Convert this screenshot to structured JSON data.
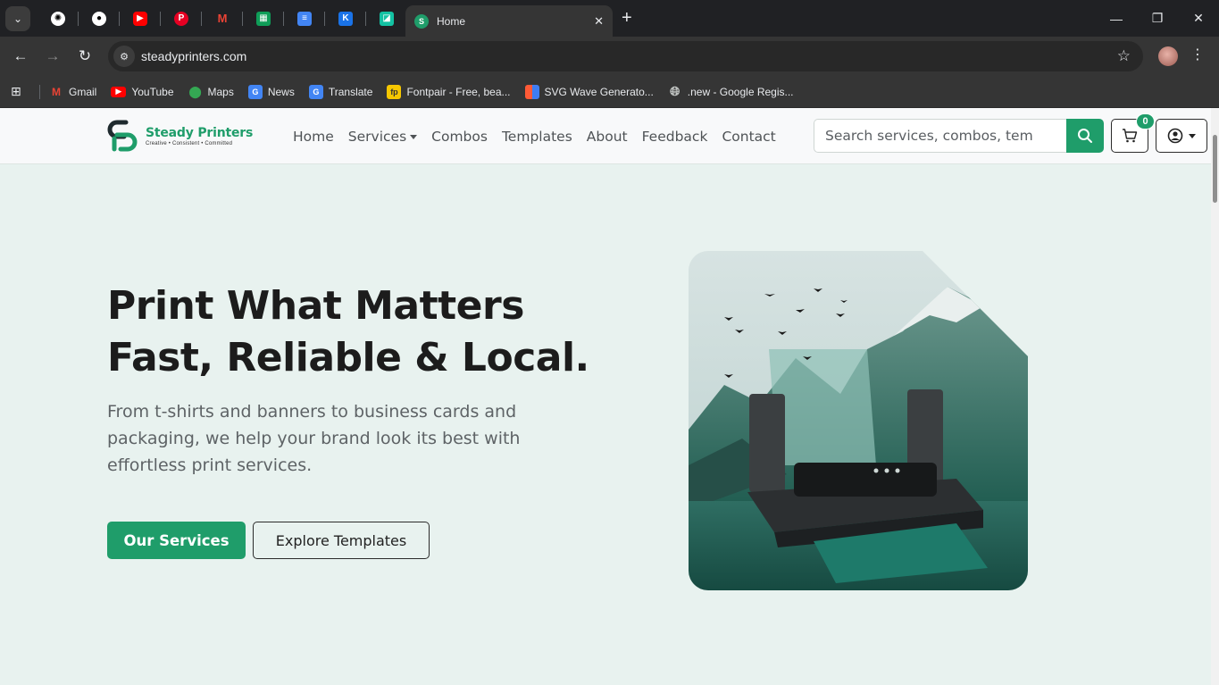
{
  "browser": {
    "tab_title": "Home",
    "url": "steadyprinters.com",
    "pinned_tabs": [
      {
        "icon": "openai-icon",
        "color": "#5f6368"
      },
      {
        "icon": "github-icon",
        "color": "#202124"
      },
      {
        "icon": "youtube-icon",
        "color": "#ff0000"
      },
      {
        "icon": "pinterest-icon",
        "color": "#e60023"
      },
      {
        "icon": "gmail-icon",
        "color": "#202124"
      },
      {
        "icon": "sheets-icon",
        "color": "#0f9d58"
      },
      {
        "icon": "docs-icon",
        "color": "#4285f4"
      },
      {
        "icon": "app-icon",
        "color": "#1a73e8"
      },
      {
        "icon": "app-icon",
        "color": "#13c2a3"
      }
    ],
    "bookmarks": [
      {
        "label": "Gmail",
        "icon": "gmail-icon",
        "color": "#ea4335"
      },
      {
        "label": "YouTube",
        "icon": "youtube-icon",
        "color": "#ff0000"
      },
      {
        "label": "Maps",
        "icon": "maps-icon",
        "color": "#34a853"
      },
      {
        "label": "News",
        "icon": "news-icon",
        "color": "#4285f4"
      },
      {
        "label": "Translate",
        "icon": "translate-icon",
        "color": "#4285f4"
      },
      {
        "label": "Fontpair - Free, bea...",
        "icon": "fontpair-icon",
        "color": "#f6c700"
      },
      {
        "label": "SVG Wave Generato...",
        "icon": "svgwave-icon",
        "color": "#ff5a36"
      },
      {
        "label": ".new - Google Regis...",
        "icon": "globe-icon",
        "color": "#9aa0a6"
      }
    ]
  },
  "site": {
    "brand": {
      "name": "Steady Printers",
      "tagline": "Creative • Consistent • Committed",
      "color": "#1f9d6a"
    },
    "nav": {
      "home": "Home",
      "services": "Services",
      "combos": "Combos",
      "templates": "Templates",
      "about": "About",
      "feedback": "Feedback",
      "contact": "Contact"
    },
    "search": {
      "placeholder": "Search services, combos, tem"
    },
    "cart_count": "0"
  },
  "hero": {
    "title_line1": "Print What Matters",
    "title_line2": "Fast, Reliable & Local.",
    "subtitle": "From t-shirts and banners to business cards and packaging, we help your brand look its best with effortless print services.",
    "primary_button": "Our Services",
    "secondary_button": "Explore Templates"
  }
}
